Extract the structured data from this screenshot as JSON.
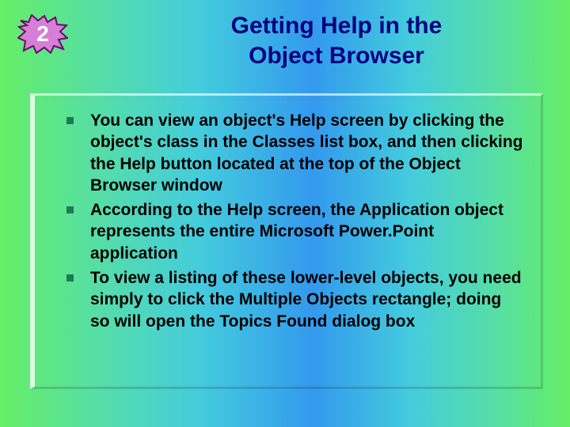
{
  "slide": {
    "number": "2",
    "title_line1": "Getting Help in the",
    "title_line2": "Object Browser"
  },
  "bullets": [
    "You can view an object's Help screen by clicking the object's class in the Classes list box, and then clicking the Help button located at the top of the Object Browser window",
    "According to the Help screen, the Application object represents the entire Microsoft Power.Point application",
    "To view a listing of these lower-level objects, you need simply to click the Multiple Objects rectangle; doing so will open the Topics Found dialog box"
  ],
  "colors": {
    "badge_fill": "#d67fd6",
    "badge_stroke": "#6b0a6b",
    "title": "#000080",
    "bullet_marker": "#1a7a5a"
  }
}
